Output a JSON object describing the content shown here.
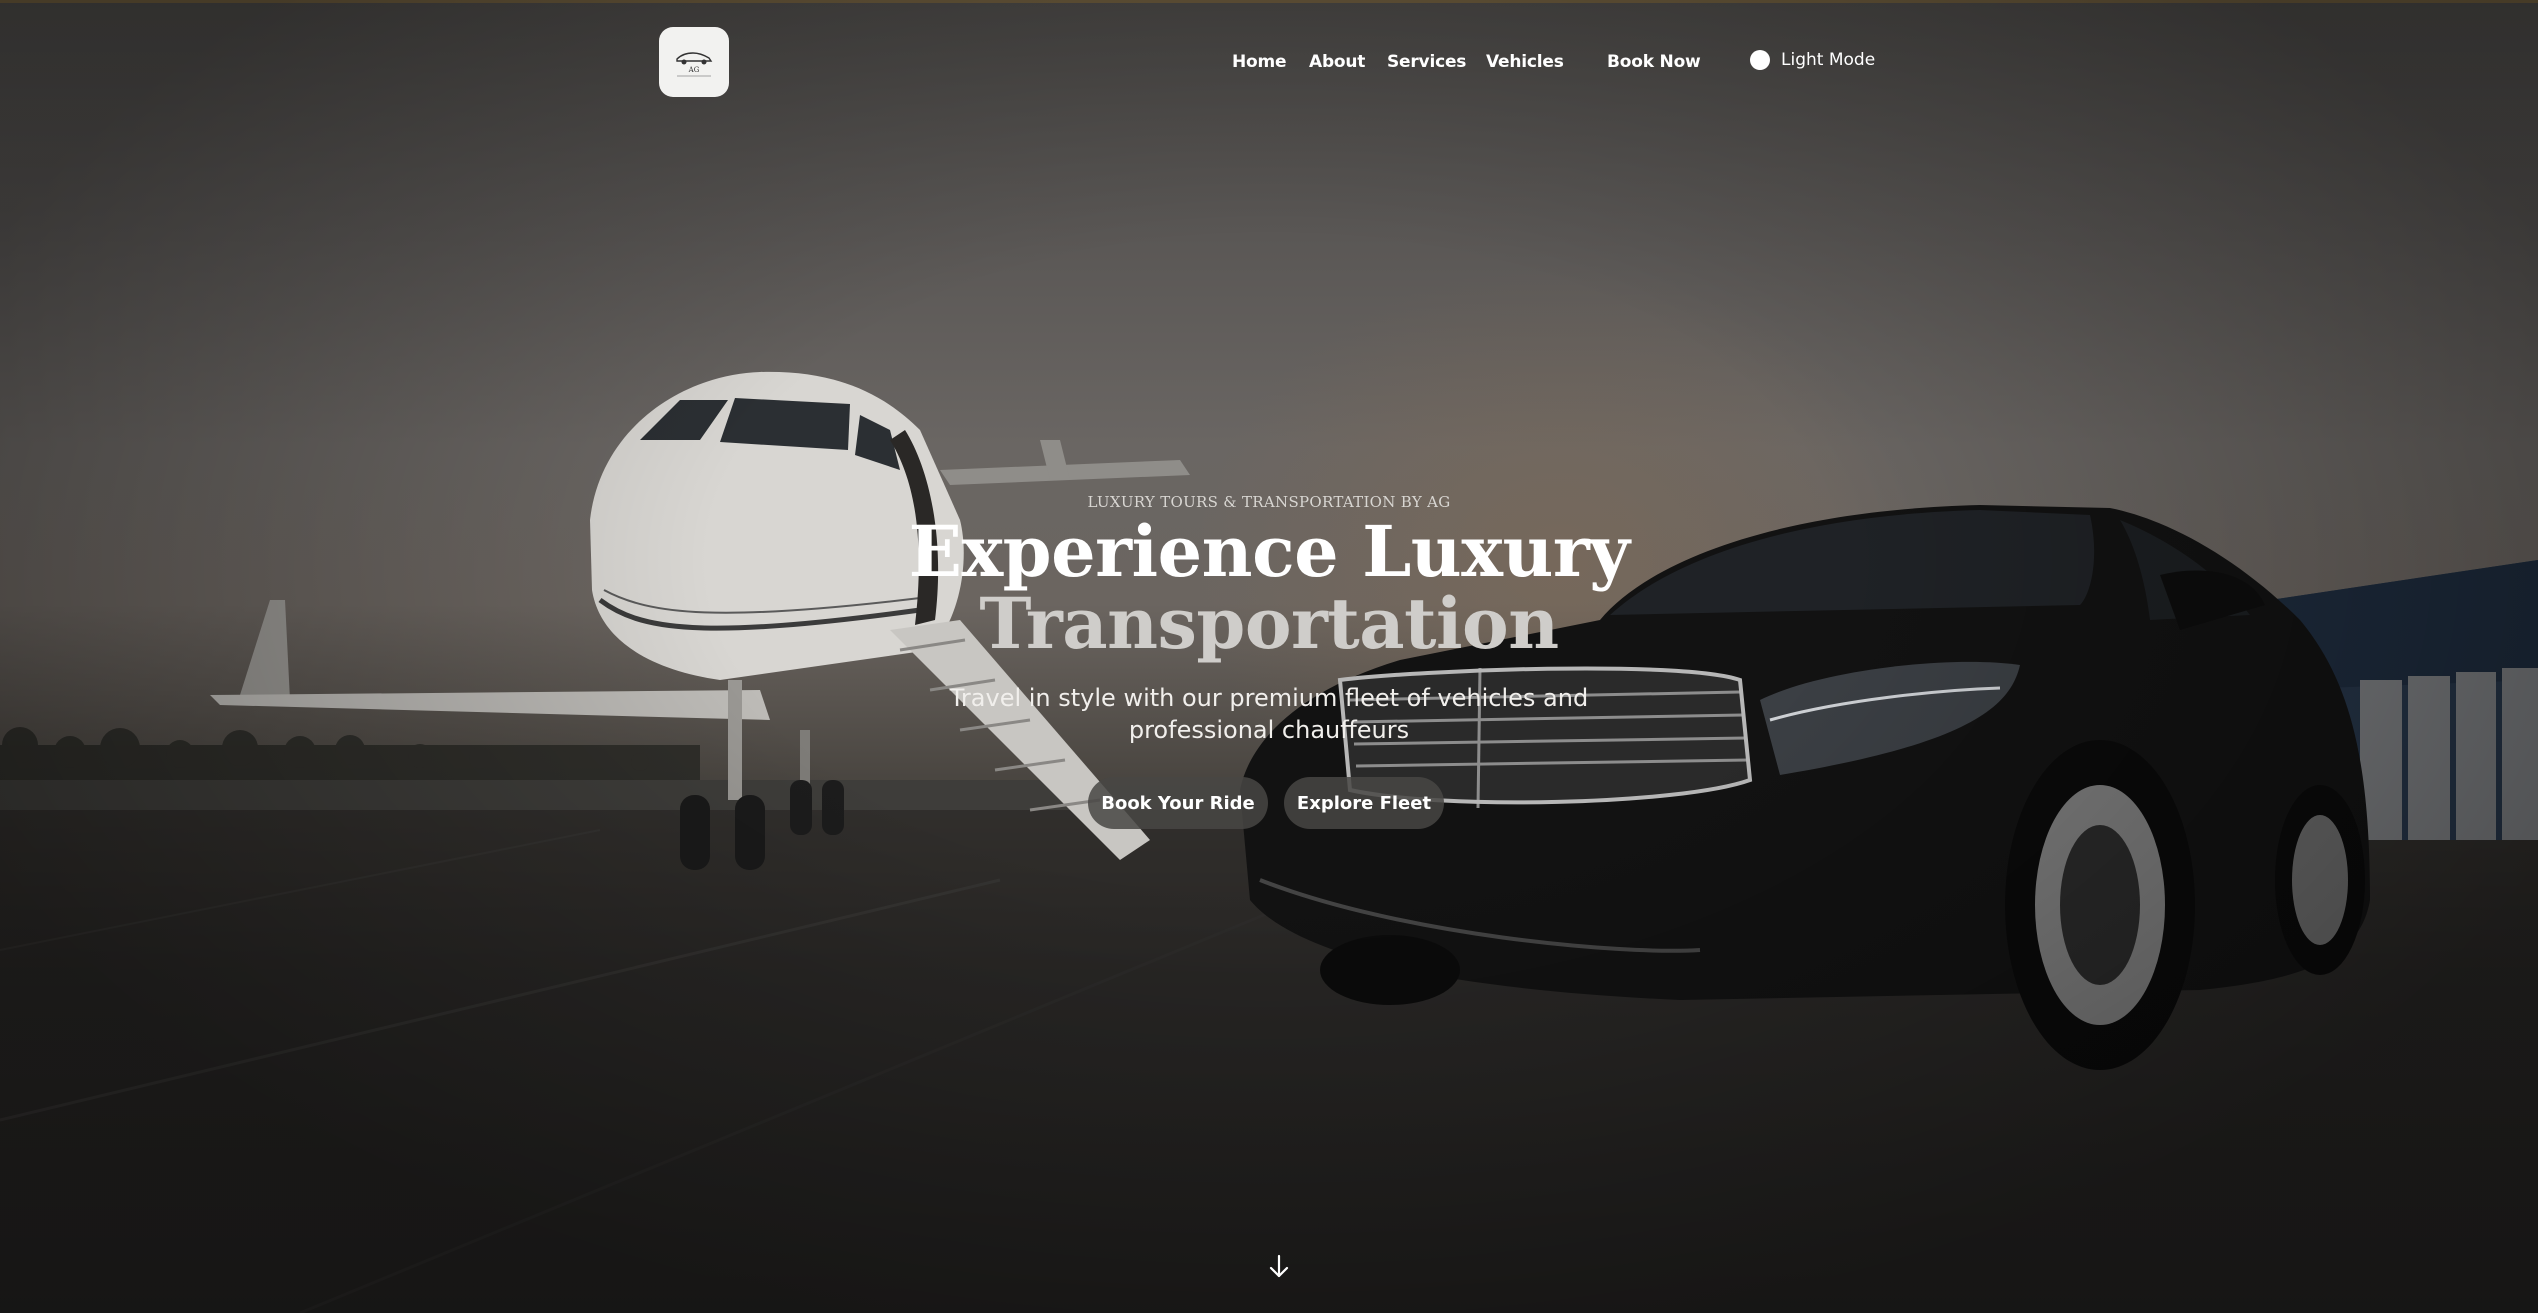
{
  "nav": {
    "logo_text": "AG",
    "links": [
      {
        "label": "Home"
      },
      {
        "label": "About"
      },
      {
        "label": "Services"
      },
      {
        "label": "Vehicles"
      }
    ],
    "book_label": "Book Now",
    "theme_toggle_label": "Light Mode"
  },
  "hero": {
    "eyebrow": "LUXURY TOURS & TRANSPORTATION BY AG",
    "title_line1": "Experience Luxury",
    "title_line2": "Transportation",
    "subtitle": "Travel in style with our premium fleet of vehicles and professional chauffeurs",
    "primary_cta": "Book Your Ride",
    "secondary_cta": "Explore Fleet"
  },
  "icons": {
    "scroll": "arrow-down-icon",
    "logo": "car-logo-icon",
    "theme": "sun-dot-icon"
  },
  "colors": {
    "accent_line": "#6b5a3c",
    "button_bg": "#484644",
    "logo_bg": "#f2f2f0",
    "title_secondary": "#cfcdca"
  }
}
